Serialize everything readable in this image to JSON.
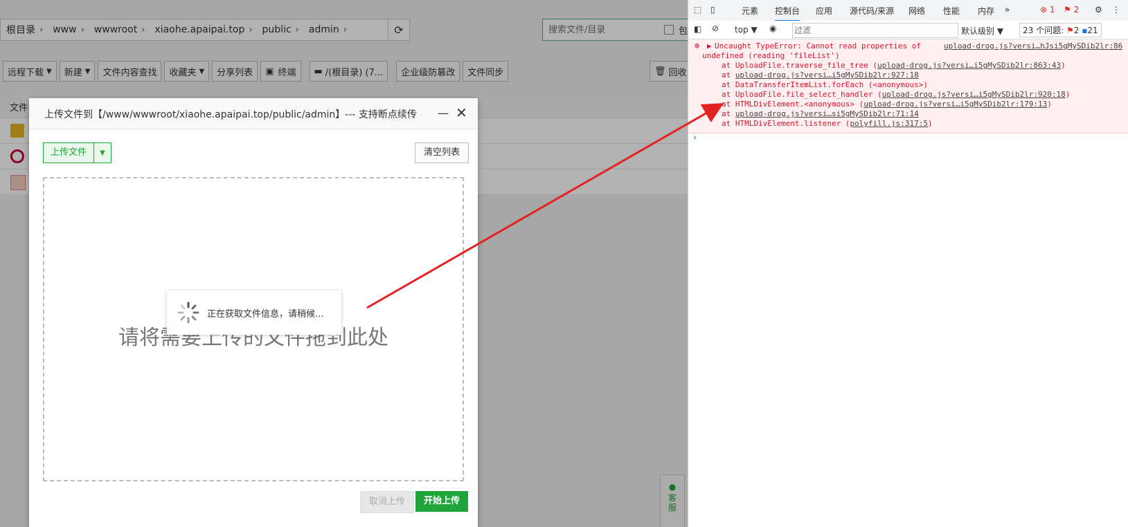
{
  "breadcrumb": [
    "根目录",
    "www",
    "wwwroot",
    "xiaohe.apaipai.top",
    "public",
    "admin"
  ],
  "search": {
    "placeholder": "搜索文件/目录",
    "include_label": "包"
  },
  "toolbar": {
    "remote_download": "远程下载",
    "new": "新建",
    "content_search": "文件内容查找",
    "favorites": "收藏夹",
    "share_list": "分享列表",
    "terminal": "终端",
    "root_disk": "/(根目录) (7...",
    "tamper": "企业级防篡改",
    "file_sync": "文件同步",
    "recycle": "回收"
  },
  "file_header": "文件",
  "dialog": {
    "title": "上传文件到【/www/wwwroot/xiaohe.apaipai.top/public/admin】--- 支持断点续传",
    "upload_btn": "上传文件",
    "clear_btn": "清空列表",
    "drop_text": "请将需要上传的文件拖到此处",
    "cancel_btn": "取消上传",
    "start_btn": "开始上传"
  },
  "loading_text": "正在获取文件信息，请稍候...",
  "service_text": "客服",
  "devtools": {
    "tabs": [
      "元素",
      "控制台",
      "应用",
      "源代码/来源",
      "网络",
      "性能",
      "内存"
    ],
    "errors_count": "1",
    "warnings_count": "2",
    "context": "top",
    "filter_placeholder": "过滤",
    "level": "默认级别",
    "issues_label": "23 个问题:",
    "issues_err": "2",
    "issues_info": "21",
    "error_lines": [
      {
        "text": "Uncaught TypeError: Cannot read properties of",
        "link": "upload-drog.js?versi…hJsi5gMySDib2lr:86"
      },
      {
        "text": "undefined (reading 'fileList')",
        "link": ""
      },
      {
        "text": "at UploadFile.traverse_file_tree (",
        "link": "upload-drog.js?versi…i5gMySDib2lr:863:43",
        "tail": ")"
      },
      {
        "text": "at ",
        "link": "upload-drog.js?versi…i5gMySDib2lr:927:18",
        "tail": ""
      },
      {
        "text": "at DataTransferItemList.forEach (<anonymous>)",
        "link": "",
        "tail": ""
      },
      {
        "text": "at UploadFile.file_select_handler (",
        "link": "upload-drog.js?versi…i5gMySDib2lr:920:18",
        "tail": ")"
      },
      {
        "text": "at HTMLDivElement.<anonymous> (",
        "link": "upload-drog.js?versi…i5gMySDib2lr:179:13",
        "tail": ")"
      },
      {
        "text": "at ",
        "link": "upload-drog.js?versi…si5gMySDib2lr:71:14",
        "tail": ""
      },
      {
        "text": "at HTMLDivElement.listener (",
        "link": "polyfill.js:317:5",
        "tail": ")"
      }
    ]
  }
}
